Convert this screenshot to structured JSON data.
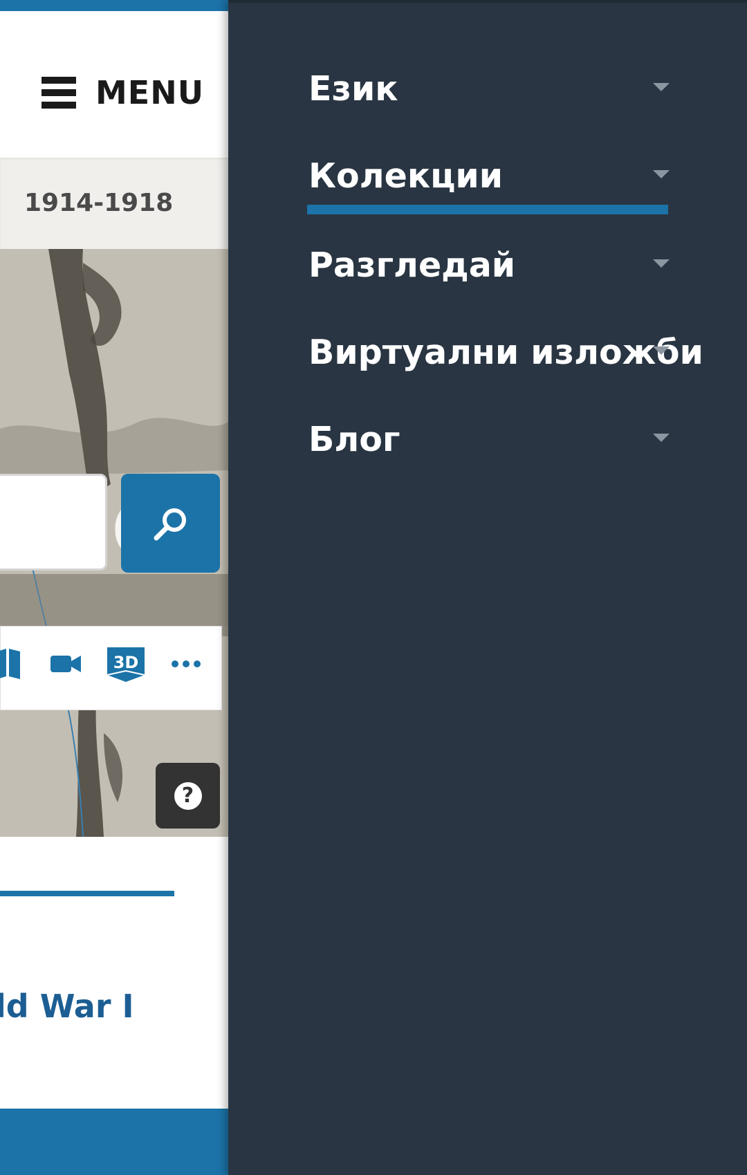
{
  "header": {
    "menu_label": "MENU"
  },
  "breadcrumb": {
    "text": "1914-1918"
  },
  "hero": {
    "ghost_text": "e"
  },
  "media_icons": [
    "book-icon",
    "video-camera-icon",
    "3d-icon",
    "more-icon"
  ],
  "lower": {
    "article_title": "ld War I"
  },
  "drawer": {
    "items": [
      {
        "label": "Език",
        "has_caret": true
      },
      {
        "label": "Колекции",
        "has_caret": true,
        "active": true
      },
      {
        "label": "Разгледай",
        "has_caret": true
      },
      {
        "label": "Виртуални изложби",
        "has_caret": true
      },
      {
        "label": "Блог",
        "has_caret": true
      }
    ]
  },
  "colors": {
    "accent": "#1b73a8",
    "drawer_bg": "#293542",
    "article_title": "#1c5e93"
  }
}
